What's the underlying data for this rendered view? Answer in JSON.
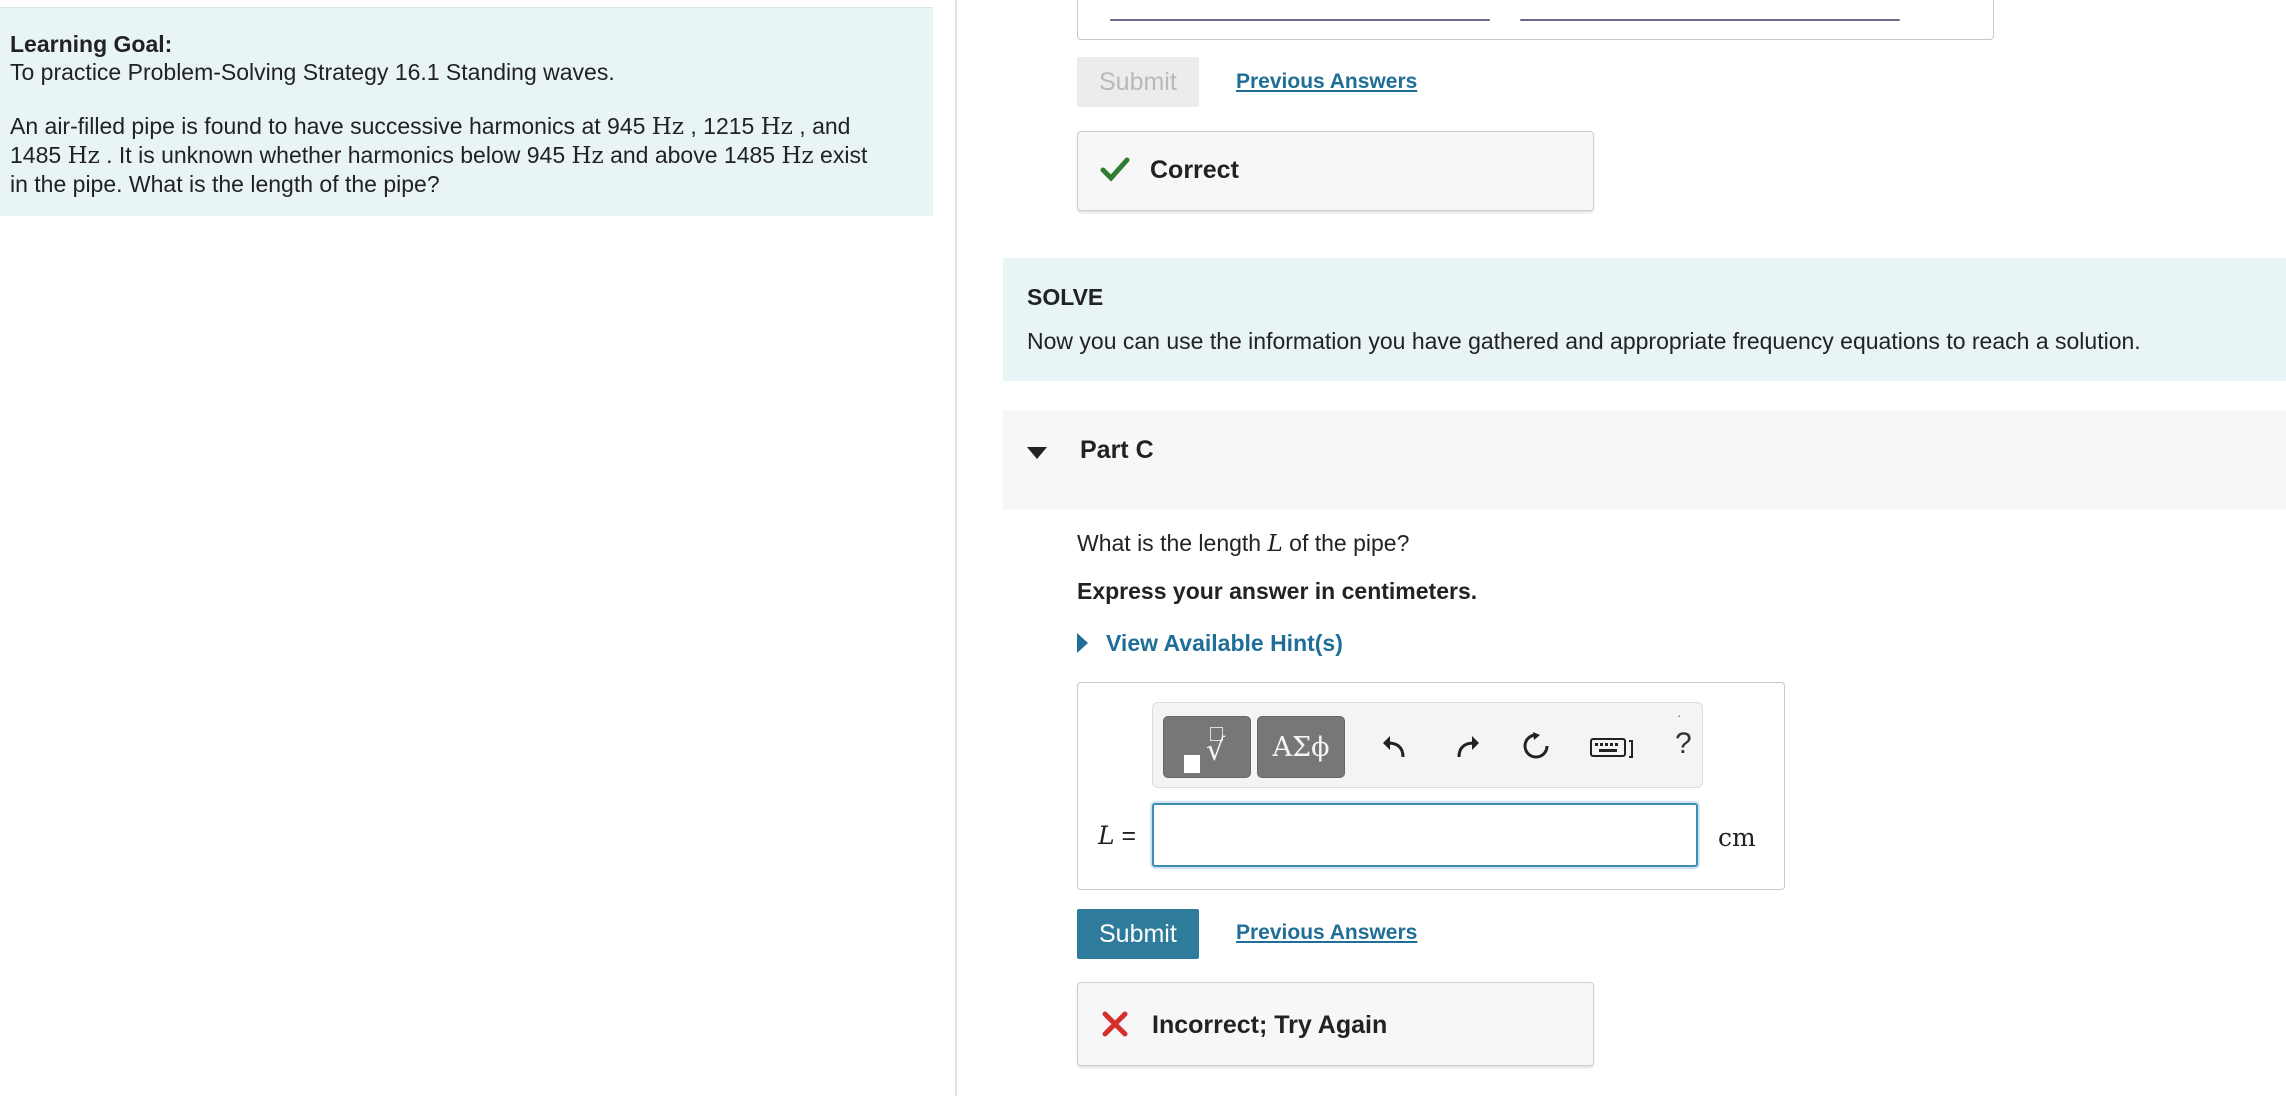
{
  "left": {
    "goal_title": "Learning Goal:",
    "goal_text": "To practice Problem-Solving Strategy 16.1 Standing waves.",
    "problem": {
      "t1": "An air-filled pipe is found to have successive harmonics at 945 ",
      "hz": "Hz",
      "t2": " , 1215 ",
      "t3": " , and",
      "t4": "1485 ",
      "t5": " . It is unknown whether harmonics below 945 ",
      "t6": " and above 1485 ",
      "t7": " exist",
      "t8": "in the pipe. What is the length of the pipe?"
    }
  },
  "previous_part": {
    "submit_label": "Submit",
    "previous_answers_label": "Previous Answers",
    "feedback_text": "Correct"
  },
  "solve": {
    "title": "SOLVE",
    "text": "Now you can use the information you have gathered and appropriate frequency equations to reach a solution."
  },
  "part_c": {
    "title": "Part C",
    "question_pre": "What is the length ",
    "question_var": "L",
    "question_post": " of the pipe?",
    "instruction": "Express your answer in centimeters.",
    "hint_link": "View Available Hint(s)",
    "toolbar": {
      "templates_icon": "math-templates-icon",
      "greek_label": "ΑΣϕ",
      "help_label": "?",
      "icons": [
        "undo-icon",
        "redo-icon",
        "reset-icon",
        "keyboard-icon"
      ]
    },
    "var_label": "L",
    "equals": " =",
    "input_value": "",
    "unit": "cm",
    "submit_label": "Submit",
    "previous_answers_label": "Previous Answers",
    "feedback_text": "Incorrect; Try Again"
  },
  "colors": {
    "accent": "#2f7b9c",
    "link": "#1f6e97",
    "correct": "#2e7d32",
    "incorrect": "#d32f2f",
    "info_bg": "#e9f4f6"
  }
}
